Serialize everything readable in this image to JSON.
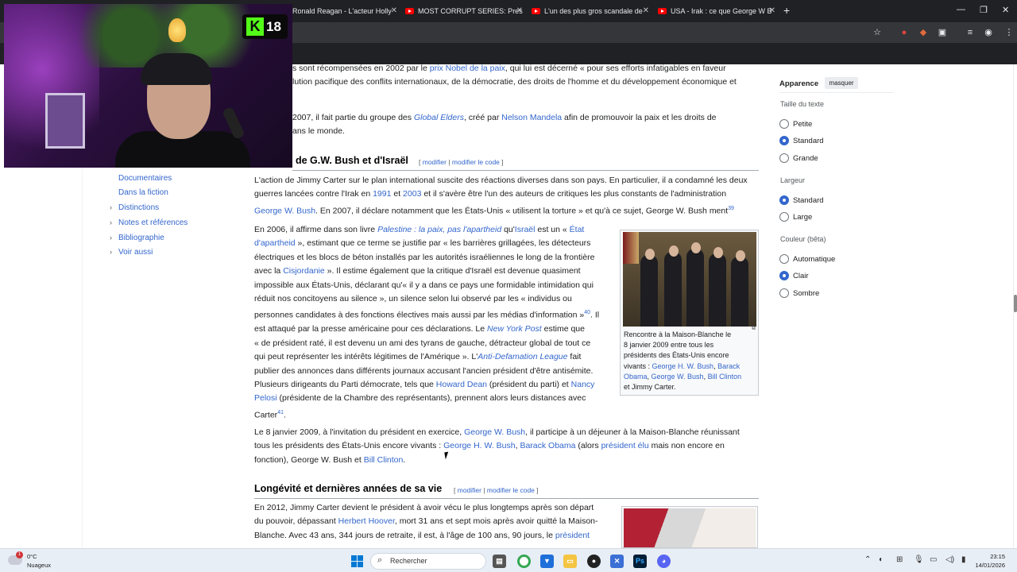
{
  "browser": {
    "tabs": [
      {
        "label": "Ronald Reagan - L'acteur Holly"
      },
      {
        "label": "MOST CORRUPT SERIES: Presid"
      },
      {
        "label": "L'un des plus gros scandale de"
      },
      {
        "label": "USA - Irak : ce que George W B"
      }
    ],
    "newtab": "+",
    "window_controls": [
      "—",
      "❐",
      "✕"
    ]
  },
  "webcam": {
    "badge_number": "18"
  },
  "toc": {
    "items": [
      {
        "label": "Documentaires",
        "expandable": false
      },
      {
        "label": "Dans la fiction",
        "expandable": false
      },
      {
        "label": "Distinctions",
        "expandable": true
      },
      {
        "label": "Notes et références",
        "expandable": true
      },
      {
        "label": "Bibliographie",
        "expandable": true
      },
      {
        "label": "Voir aussi",
        "expandable": true
      }
    ]
  },
  "article": {
    "p0_l1a": "s sont récompensées en 2002 par le ",
    "p0_l1_link": "prix Nobel de la paix",
    "p0_l1b": ", qui lui est décerné « pour ses efforts infatigables en faveur",
    "p0_l2": "lution pacifique des conflits internationaux, de la démocratie, des droits de l'homme et du développement économique et",
    "p1_l1a": "2007, il fait partie du groupe des ",
    "p1_l1_link1": "Global Elders",
    "p1_l1b": ", créé par ",
    "p1_l1_link2": "Nelson Mandela",
    "p1_l1c": " afin de promouvoir la paix et les droits de",
    "p1_l2": "ans le monde.",
    "section1": {
      "heading": "de G.W. Bush et d'Israël",
      "edit": "modifier",
      "edit_code": "modifier le code"
    },
    "p2": {
      "l1": "L'action de Jimmy Carter sur le plan international suscite des réactions diverses dans son pays. En particulier, il a condamné les deux",
      "l2a": "guerres lancées contre l'Irak en ",
      "l2_y1": "1991",
      "l2b": " et ",
      "l2_y2": "2003",
      "l2c": " et il s'avère être l'un des auteurs de critiques les plus constants de l'administration",
      "l3_link": "George W. Bush",
      "l3b": ". En 2007, il déclare notamment que les États-Unis « utilisent la torture » et qu'à ce sujet, George W. Bush ment",
      "l3_ref": "39"
    },
    "p3": {
      "l1a": "En 2006, il affirme dans son livre ",
      "l1_book": "Palestine : la paix, pas l'apartheid",
      "l1b": " qu'",
      "l1_israel": "Israël",
      "l1c": " est un « ",
      "l1_etat": "État",
      "l2_apartheid": "d'apartheid",
      "l2b": " », estimant que ce terme se justifie par « les barrières grillagées, les détecteurs",
      "l3": "électriques et les blocs de béton installés par les autorités israéliennes le long de la frontière",
      "l4a": "avec la ",
      "l4_link": "Cisjordanie",
      "l4b": " ». Il estime également que la critique d'Israël est devenue quasiment",
      "l5": "impossible aux États-Unis, déclarant qu'« il y a dans ce pays une formidable intimidation qui",
      "l6": "réduit nos concitoyens au silence », un silence selon lui observé par les « individus ou",
      "l7": "personnes candidates à des fonctions électives mais aussi par les médias d'information »",
      "l7_ref": "40",
      "l7b": ". Il",
      "l8a": "est attaqué par la presse américaine pour ces déclarations. Le ",
      "l8_link": "New York Post",
      "l8b": " estime que",
      "l9": "« de président raté, il est devenu un ami des tyrans de gauche, détracteur global de tout ce",
      "l10a": "qui peut représenter les intérêts légitimes de l'Amérique ». L'",
      "l10_link": "Anti-Defamation League",
      "l10b": " fait",
      "l11": "publier des annonces dans différents journaux accusant l'ancien président d'être antisémite.",
      "l12a": "Plusieurs dirigeants du Parti démocrate, tels que ",
      "l12_link1": "Howard Dean",
      "l12b": " (président du parti) et ",
      "l12_link2": "Nancy",
      "l13_link": "Pelosi",
      "l13b": " (présidente de la Chambre des représentants), prennent alors leurs distances avec",
      "l14": "Carter",
      "l14_ref": "41",
      "l14b": "."
    },
    "p4": {
      "l1a": "Le 8 janvier 2009, à l'invitation du président en exercice, ",
      "l1_link": "George W. Bush",
      "l1b": ", il participe à un déjeuner à la Maison-Blanche réunissant",
      "l2a": "tous les présidents des États-Unis encore vivants : ",
      "l2_link1": "George H. W. Bush",
      "l2_sep": ", ",
      "l2_link2": "Barack Obama",
      "l2b": " (alors ",
      "l2_link3": "président élu",
      "l2c": " mais non encore en",
      "l3a": "fonction), George W. Bush et ",
      "l3_link": "Bill Clinton",
      "l3b": "."
    },
    "section2": {
      "heading": "Longévité et dernières années de sa vie",
      "edit": "modifier",
      "edit_code": "modifier le code"
    },
    "p5": {
      "l1": "En 2012, Jimmy Carter devient le président à avoir vécu le plus longtemps après son départ",
      "l2a": "du pouvoir, dépassant ",
      "l2_link": "Herbert Hoover",
      "l2b": ", mort 31 ans et sept mois après avoir quitté la Maison-",
      "l3a": "Blanche. Avec 43 ans, 344 jours de retraite, il est, à l'âge de 100 ans, 90 jours, le ",
      "l3_link": "président"
    },
    "figure": {
      "c1": "Rencontre à la Maison-Blanche le",
      "c2": "8 janvier 2009 entre tous les",
      "c3": "présidents des États-Unis encore",
      "c4a": "vivants : ",
      "c4_link": "George H. W. Bush",
      "c4b": ", ",
      "c4_link2": "Barack",
      "c5_link": "Obama",
      "c5b": ", ",
      "c5_link2": "George W. Bush",
      "c5c": ", ",
      "c5_link3": "Bill Clinton",
      "c6": "et Jimmy Carter."
    }
  },
  "appearance": {
    "title": "Apparence",
    "hide": "masquer",
    "text_size_label": "Taille du texte",
    "text_sizes": [
      "Petite",
      "Standard",
      "Grande"
    ],
    "text_size_selected": "Standard",
    "width_label": "Largeur",
    "widths": [
      "Standard",
      "Large"
    ],
    "width_selected": "Standard",
    "color_label": "Couleur (bêta)",
    "colors": [
      "Automatique",
      "Clair",
      "Sombre"
    ],
    "color_selected": "Clair"
  },
  "taskbar": {
    "weather_badge": "1",
    "temp": "0°C",
    "weather": "Nuageux",
    "search_placeholder": "Rechercher",
    "time": "23:15",
    "date": "14/01/2026"
  }
}
